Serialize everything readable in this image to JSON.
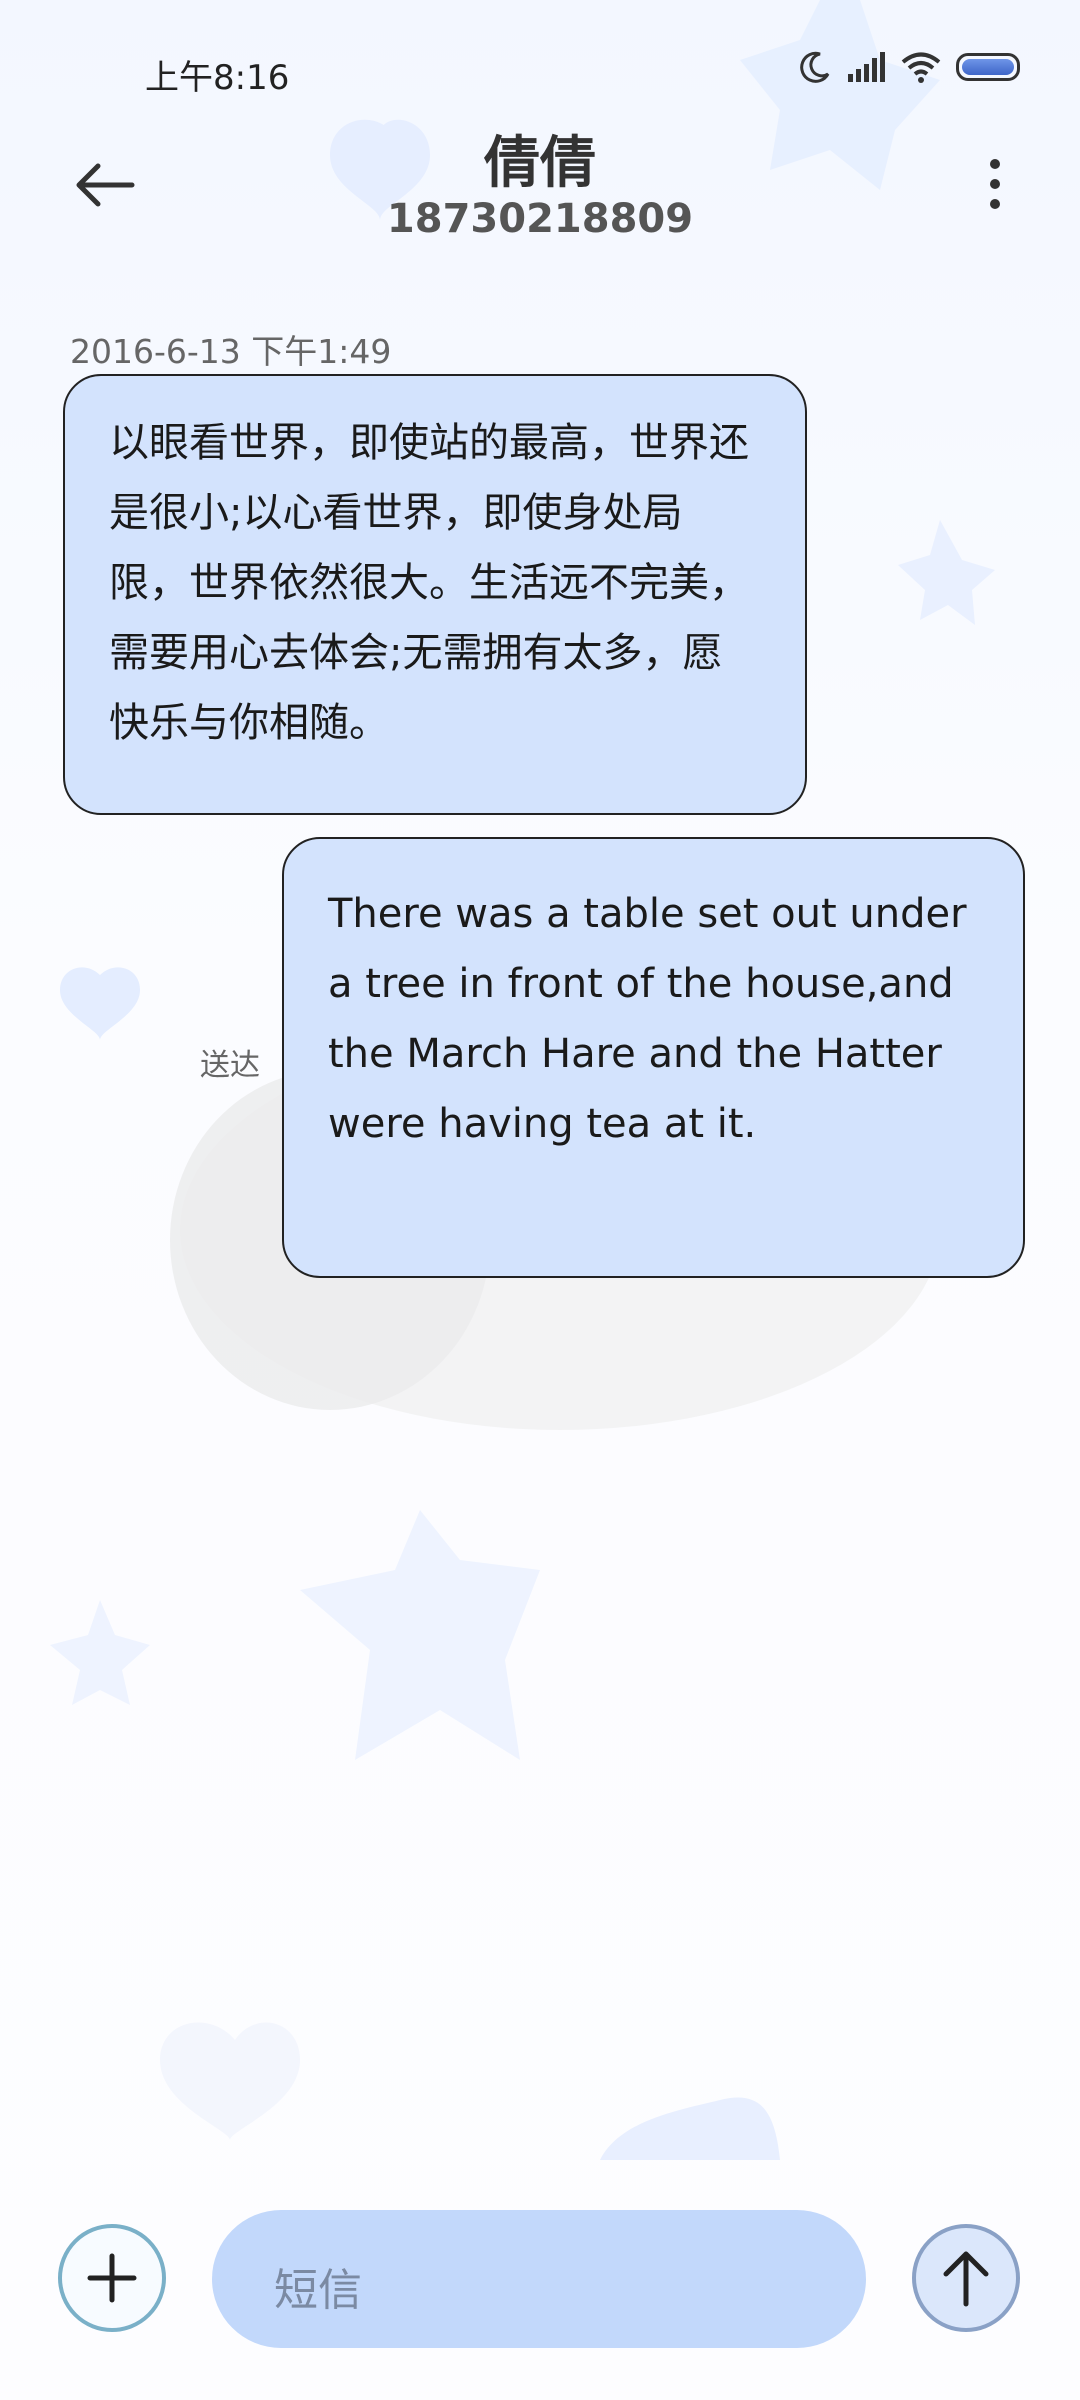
{
  "status_bar": {
    "time": "上午8:16",
    "icons": [
      "moon-icon",
      "signal-icon",
      "wifi-icon",
      "battery-icon"
    ]
  },
  "header": {
    "contact_name": "倩倩",
    "phone_number": "18730218809",
    "back_icon": "arrow-left-icon",
    "menu_icon": "more-vertical-icon"
  },
  "conversation": {
    "timestamp": "2016-6-13 下午1:49",
    "messages": [
      {
        "direction": "incoming",
        "text": "以眼看世界，即使站的最高，世界还是很小;以心看世界，即使身处局限，世界依然很大。生活远不完美，需要用心去体会;无需拥有太多，愿快乐与你相随。"
      },
      {
        "direction": "outgoing",
        "text": "There was a table set out under a tree in front of the house,and the March Hare and the Hatter were having tea at it.",
        "status": "送达"
      }
    ]
  },
  "composer": {
    "add_icon": "plus-icon",
    "placeholder": "短信",
    "send_icon": "arrow-up-icon"
  },
  "colors": {
    "bubble_fill": "#d3e3fd",
    "input_fill": "#c2d8fb",
    "background": "#f7f9ff"
  }
}
